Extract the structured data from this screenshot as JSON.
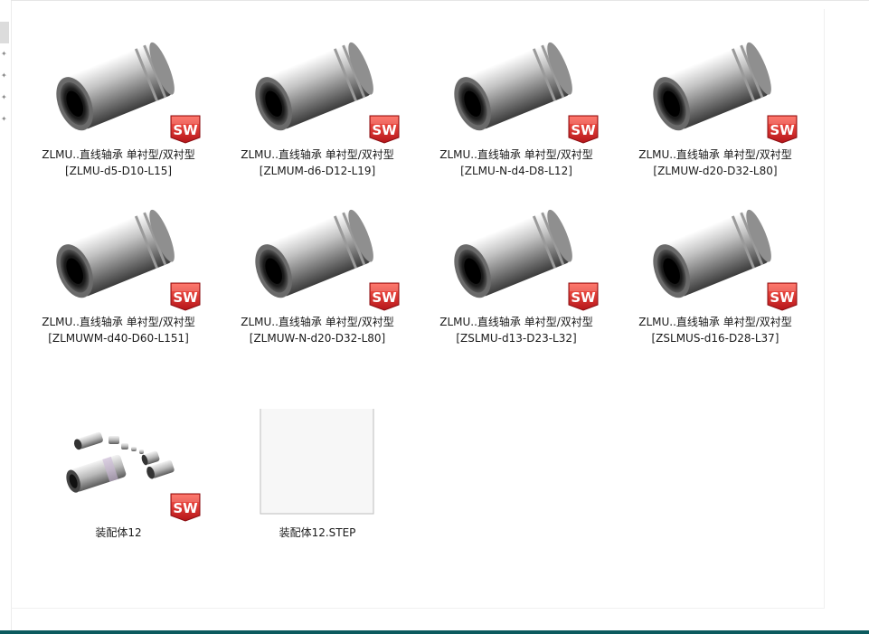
{
  "files": [
    {
      "line1": "ZLMU..直线轴承 单衬型/双衬型",
      "line2": "[ZLMU-d5-D10-L15]"
    },
    {
      "line1": "ZLMU..直线轴承 单衬型/双衬型",
      "line2": "[ZLMUM-d6-D12-L19]"
    },
    {
      "line1": "ZLMU..直线轴承 单衬型/双衬型",
      "line2": "[ZLMU-N-d4-D8-L12]"
    },
    {
      "line1": "ZLMU..直线轴承 单衬型/双衬型",
      "line2": "[ZLMUW-d20-D32-L80]"
    },
    {
      "line1": "ZLMU..直线轴承 单衬型/双衬型",
      "line2": "[ZLMUWM-d40-D60-L151]"
    },
    {
      "line1": "ZLMU..直线轴承 单衬型/双衬型",
      "line2": "[ZLMUW-N-d20-D32-L80]"
    },
    {
      "line1": "ZLMU..直线轴承 单衬型/双衬型",
      "line2": "[ZSLMU-d13-D23-L32]"
    },
    {
      "line1": "ZLMU..直线轴承 单衬型/双衬型",
      "line2": "[ZSLMUS-d16-D28-L37]"
    },
    {
      "line1": "装配体12",
      "line2": ""
    },
    {
      "line1": "装配体12.STEP",
      "line2": ""
    }
  ],
  "badge": {
    "text": "SW",
    "color": "#d8262b"
  },
  "icons": {
    "quick_access_pins": "pin-icon",
    "part_thumbnail": "linear-bearing-icon",
    "assembly_thumbnail": "assembly-icon",
    "generic_file": "blank-document-icon"
  }
}
